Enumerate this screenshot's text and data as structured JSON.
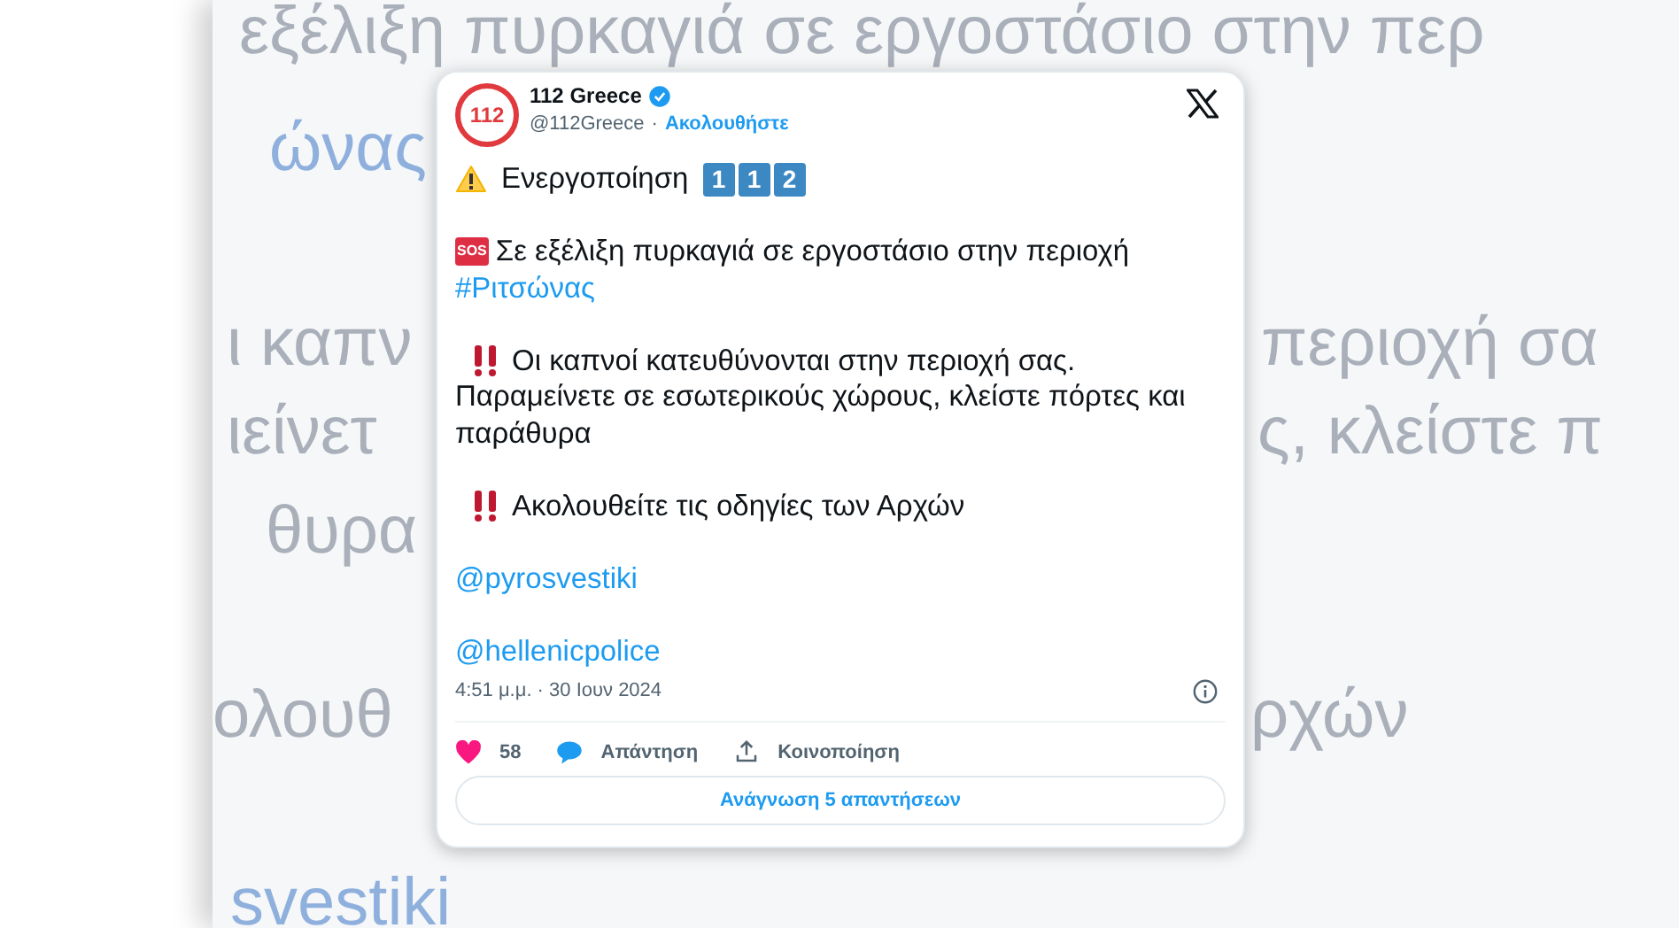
{
  "background": {
    "fragments": [
      {
        "text": "εξέλιξη πυρκαγιά σε εργοστάσιο στην περ",
        "kind": "plain"
      },
      {
        "text": "ώνας",
        "kind": "link"
      },
      {
        "text": "ι καπν",
        "kind": "plain"
      },
      {
        "text": "ιείνετ",
        "kind": "plain"
      },
      {
        "text": "θυρα",
        "kind": "plain"
      },
      {
        "text": "ολουθ",
        "kind": "plain"
      },
      {
        "text": "svestiki",
        "kind": "link"
      },
      {
        "text": "περιοχή σα",
        "kind": "plain"
      },
      {
        "text": "ς, κλείστε π",
        "kind": "plain"
      },
      {
        "text": "ρχών",
        "kind": "plain"
      }
    ]
  },
  "tweet": {
    "avatar_text": "112",
    "name": "112 Greece",
    "verified": true,
    "handle": "@112Greece",
    "separator": "·",
    "follow": "Ακολουθήστε",
    "paragraphs": [
      {
        "kind": "activation",
        "text": "Ενεργοποίηση",
        "keys": [
          "1",
          "1",
          "2"
        ]
      },
      {
        "kind": "sos",
        "badge": "SOS",
        "text": "Σε εξέλιξη πυρκαγιά σε εργοστάσιο στην περιοχή",
        "hashtag": "#Ριτσώνας"
      },
      {
        "kind": "alert",
        "text": "Οι καπνοί κατευθύνονται στην περιοχή σας.",
        "continuation": "Παραμείνετε σε εσωτερικούς χώρους, κλείστε πόρτες και παράθυρα"
      },
      {
        "kind": "alert",
        "text": "Ακολουθείτε τις οδηγίες των Αρχών"
      },
      {
        "kind": "mention",
        "text": "@pyrosvestiki"
      },
      {
        "kind": "mention",
        "text": "@hellenicpolice"
      }
    ],
    "timestamp": "4:51 μ.μ. · 30 Ιουν 2024",
    "actions": [
      {
        "kind": "like",
        "text": "58"
      },
      {
        "kind": "reply",
        "text": "Απάντηση"
      },
      {
        "kind": "share",
        "text": "Κοινοποίηση"
      }
    ],
    "read_replies": "Ανάγνωση 5 απαντήσεων"
  }
}
